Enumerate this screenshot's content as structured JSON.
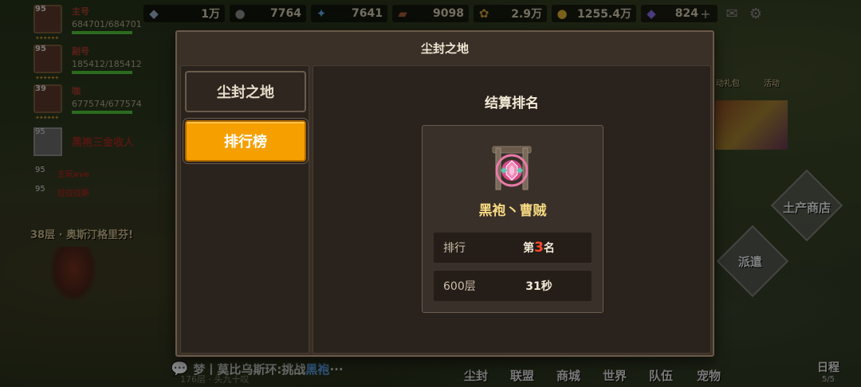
{
  "resources": [
    {
      "icon": "crystal-icon",
      "value": "1万"
    },
    {
      "icon": "ore-icon",
      "value": "7764"
    },
    {
      "icon": "blue-gem-icon",
      "value": "7641"
    },
    {
      "icon": "wood-icon",
      "value": "9098"
    },
    {
      "icon": "wheat-icon",
      "value": "2.9万"
    },
    {
      "icon": "gold-coin-icon",
      "value": "1255.4万"
    },
    {
      "icon": "diamond-icon",
      "value": "824"
    }
  ],
  "players": [
    {
      "level": "95",
      "name": "主号",
      "hp": "684701/684701",
      "bar": 1.0
    },
    {
      "level": "95",
      "name": "副号",
      "hp": "185412/185412",
      "bar": 1.0
    },
    {
      "level": "39",
      "name": "咖",
      "hp": "677574/677574",
      "bar": 1.0
    }
  ],
  "mini_players": [
    {
      "level": "95",
      "name": "黑袍三金收人"
    },
    {
      "level": "95",
      "name": "主玩ave"
    },
    {
      "level": "95",
      "name": "拉拉拉斯"
    }
  ],
  "floor_text": "38层 · 奥斯汀格里芬!",
  "side_buttons": {
    "shop": "土产商店",
    "dispatch": "派遣",
    "gift": "动礼包",
    "activity": "活动"
  },
  "chat": {
    "prefix": "梦丨莫比乌斯环:挑战",
    "highlight": "黑袍",
    "suffix": "···",
    "sub": "176层 · 头九十叹"
  },
  "bottom_nav": [
    "尘封",
    "联盟",
    "商城",
    "世界",
    "队伍",
    "宠物"
  ],
  "schedule": {
    "label": "日程",
    "count": "5/5"
  },
  "modal": {
    "title": "尘封之地",
    "tabs": [
      "尘封之地",
      "排行榜"
    ],
    "heading": "结算排名",
    "player_name": "黑袍丶曹贼",
    "rank_label": "排行",
    "rank_prefix": "第",
    "rank_value": "3",
    "rank_suffix": "名",
    "floor_label": "600层",
    "time_value": "31秒"
  }
}
